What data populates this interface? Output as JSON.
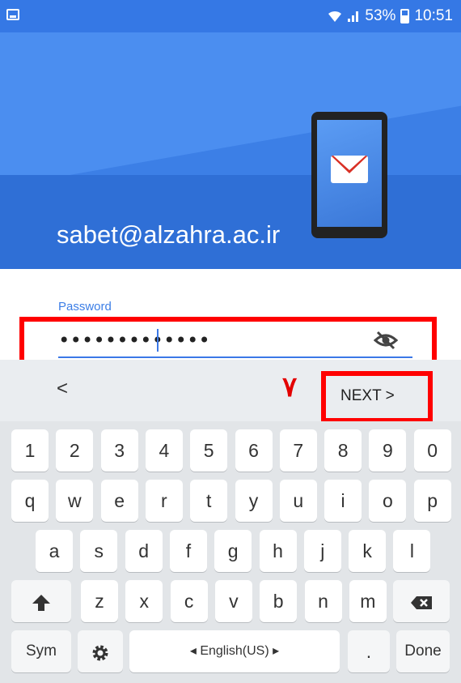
{
  "status_bar": {
    "battery": "53%",
    "time": "10:51",
    "icons": [
      "gallery-icon",
      "wifi-icon",
      "signal-icon",
      "battery-icon"
    ]
  },
  "account": {
    "email": "sabet@alzahra.ac.ir",
    "header_icon": "gmail-icon"
  },
  "password": {
    "label": "Password",
    "masked_value": "•••••••••••••",
    "visibility_icon": "eye-off-icon"
  },
  "nav_row": {
    "prev_label": "<",
    "step_marker": "۷",
    "next_label": "NEXT >"
  },
  "keyboard": {
    "row1": [
      "1",
      "2",
      "3",
      "4",
      "5",
      "6",
      "7",
      "8",
      "9",
      "0"
    ],
    "row2": [
      "q",
      "w",
      "e",
      "r",
      "t",
      "y",
      "u",
      "i",
      "o",
      "p"
    ],
    "row3": [
      "a",
      "s",
      "d",
      "f",
      "g",
      "h",
      "j",
      "k",
      "l"
    ],
    "row4": [
      "z",
      "x",
      "c",
      "v",
      "b",
      "n",
      "m"
    ],
    "sym_label": "Sym",
    "space_label": "◂ English(US) ▸",
    "period_label": ".",
    "done_label": "Done"
  },
  "colors": {
    "header_blue": "#3c7fe6",
    "accent_blue": "#3b78e7",
    "highlight_red": "#ff0000"
  }
}
